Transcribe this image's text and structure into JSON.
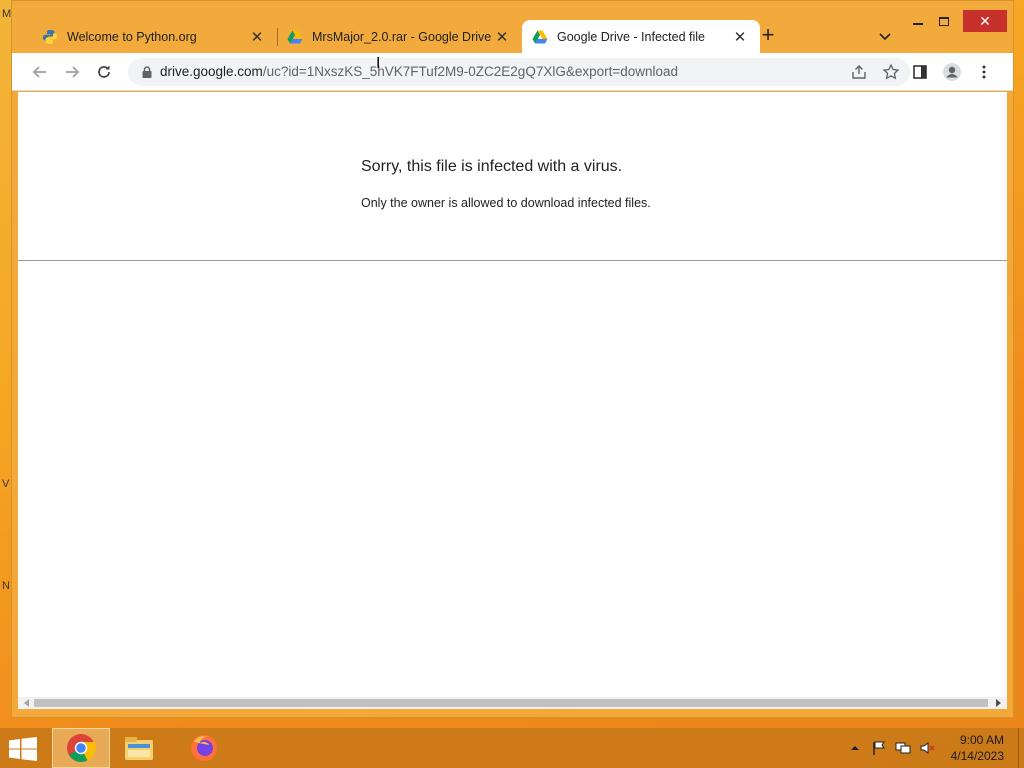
{
  "window": {
    "controls": {
      "minimize": "minimize",
      "maximize": "maximize",
      "close": "✕"
    }
  },
  "tabs": [
    {
      "title": "Welcome to Python.org",
      "icon": "python-icon",
      "close": "✕"
    },
    {
      "title": "MrsMajor_2.0.rar - Google Drive",
      "icon": "google-drive-icon",
      "close": "✕"
    },
    {
      "title": "Google Drive - Infected file",
      "icon": "google-drive-icon",
      "close": "✕",
      "active": true
    }
  ],
  "new_tab_label": "+",
  "address_bar": {
    "host": "drive.google.com",
    "path": "/uc?id=1NxszKS_5hVK7FTuf2M9-0ZC2E2gQ7XlG&export=download"
  },
  "page": {
    "title": "Sorry, this file is infected with a virus.",
    "body": "Only the owner is allowed to download infected files."
  },
  "desktop_glyphs": [
    "M",
    "V",
    "N"
  ],
  "taskbar": {
    "apps": [
      {
        "name": "Google Chrome",
        "icon": "chrome-icon",
        "active": true
      },
      {
        "name": "File Explorer",
        "icon": "file-explorer-icon",
        "active": false
      },
      {
        "name": "Firefox",
        "icon": "firefox-icon",
        "active": false
      }
    ],
    "tray_icons": [
      "chevron-up-icon",
      "action-center-flag-icon",
      "network-icon",
      "volume-muted-icon"
    ],
    "clock": {
      "time": "9:00 AM",
      "date": "4/14/2023"
    }
  },
  "colors": {
    "desktop": "#f6a623",
    "window_frame": "#f2aa3c",
    "close_button": "#c7312b",
    "taskbar": "#c97a18"
  }
}
